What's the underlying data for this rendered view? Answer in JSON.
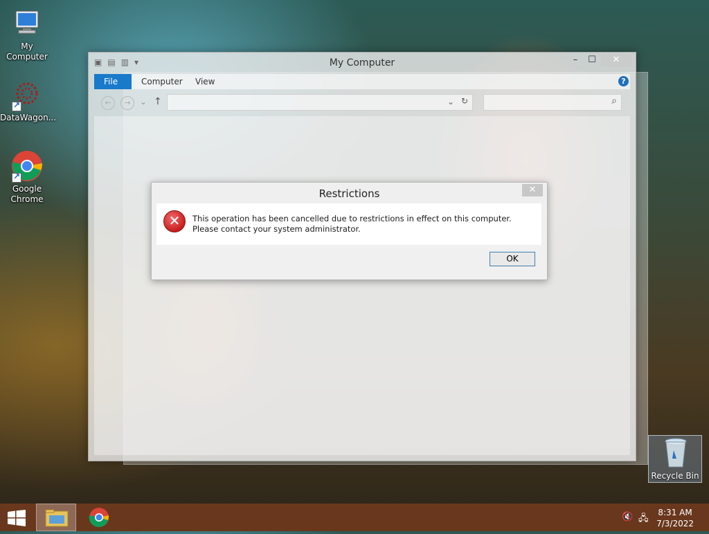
{
  "desktop": {
    "icons": [
      {
        "label": "My Computer"
      },
      {
        "label": "DataWagon..."
      },
      {
        "label": "Google Chrome"
      }
    ],
    "recycle_bin": {
      "label": "Recycle Bin"
    }
  },
  "explorer": {
    "title": "My Computer",
    "ribbon_tabs": [
      "File",
      "Computer",
      "View"
    ],
    "help": "?",
    "nav": {
      "back": "←",
      "forward": "→",
      "up": "↑",
      "refresh": "↻",
      "dropdown": "⌄",
      "search_icon": "⌕"
    },
    "window_buttons": {
      "minimize": "–",
      "maximize": "☐",
      "close": "✕"
    }
  },
  "dialog": {
    "title": "Restrictions",
    "close": "✕",
    "message": "This operation has been cancelled due to restrictions in effect on this computer. Please contact your system administrator.",
    "ok_label": "OK",
    "icon": "error-icon"
  },
  "taskbar": {
    "time": "8:31 AM",
    "date": "7/3/2022",
    "tray": [
      "speaker-muted-icon",
      "network-icon"
    ]
  },
  "colors": {
    "accent": "#1979ca",
    "error": "#c81f1f",
    "taskbar": "#7a3c1e"
  }
}
